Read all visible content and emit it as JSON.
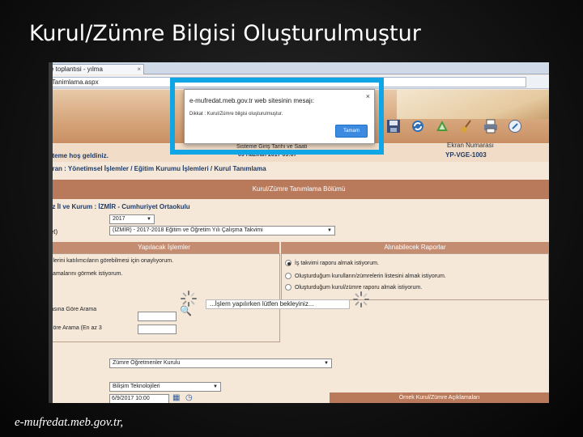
{
  "slide": {
    "title": "Kurul/Zümre Bilgisi Oluşturulmuştur",
    "footer": "e-mufredat.meb.gov.tr,"
  },
  "browser": {
    "tab_label": "e toplantısi - yılma",
    "tab_close": "×",
    "url": "iTanimlama.aspx"
  },
  "app": {
    "welcome": "steme hoş geldiniz.",
    "date_label": "Sisteme Giriş Tarihi ve Saati",
    "date_value": "09 Haziran 2017 09:07",
    "screen_no_label": "Ekran Numarası",
    "screen_no_value": "YP-VGE-1003",
    "breadcrumb": "kran : Yönetimsel İşlemler / Eğitim Kurumu İşlemleri / Kurul Tanımlama",
    "section_title": "Kurul/Zümre Tanımlama Bölümü",
    "school": "az İl ve Kurum : İZMİR - Cumhuriyet Ortaokulu",
    "year_select": "2017",
    "calendar_label": "let)",
    "calendar_select": "(İZMİR) - 2017-2018 Eğitim ve Öğretim Yılı Çalışma Takvimi",
    "left_panel_title": "Yapılacak İşlemler",
    "left_panel_items": [
      "ğilerini katılımcıların görebilmesi için onaylıyorum.",
      "klamalarını görmek istiyorum."
    ],
    "search_label_1": "rasına Göre Arama",
    "search_label_2": "Göre Arama (En az 3",
    "right_panel_title": "Alınabilecek Raporlar",
    "reports": [
      {
        "label": "İş takvimi raporu almak istiyorum.",
        "selected": true
      },
      {
        "label": "Oluşturduğum kurulların/zümrelerin listesini almak istiyorum.",
        "selected": false
      },
      {
        "label": "Oluşturduğum kurul/zümre raporu almak istiyorum.",
        "selected": false
      }
    ],
    "loading_text": "...İşlem yapılırken lütfen bekleyiniz...",
    "board_type_select": "Zümre Öğretmenler Kurulu",
    "branch_select": "Bilişim Teknolojileri",
    "datetime_value": "6/9/2017 10:00",
    "example_bar": "Örnek Kurul/Zümre Açıklamaları"
  },
  "dialog": {
    "title": "e-mufredat.meb.gov.tr web sitesinin mesajı:",
    "close": "×",
    "message": "Dikkat : Kurul/Zümre bilgisi oluşturulmuştur.",
    "ok_label": "Tamam"
  },
  "toolbar_icons": [
    "save-icon",
    "refresh-icon",
    "recycle-icon",
    "broom-icon",
    "print-icon",
    "help-icon"
  ],
  "colors": {
    "highlight": "#10a6e6",
    "ok_button": "#3d8be0",
    "section_bar": "#b97a5c"
  }
}
